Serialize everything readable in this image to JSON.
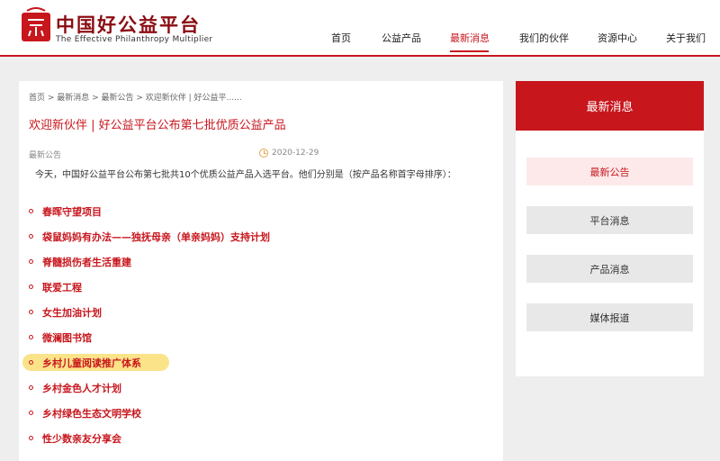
{
  "brand": {
    "name_cn": "中国好公益平台",
    "name_en": "The Effective Philanthropy Multiplier"
  },
  "nav": {
    "items": [
      {
        "label": "首页"
      },
      {
        "label": "公益产品"
      },
      {
        "label": "最新消息"
      },
      {
        "label": "我们的伙伴"
      },
      {
        "label": "资源中心"
      },
      {
        "label": "关于我们"
      }
    ],
    "active": "最新消息"
  },
  "breadcrumb": "首页 > 最新消息 > 最新公告 > 欢迎新伙伴 | 好公益平......",
  "article": {
    "title": "欢迎新伙伴 | 好公益平台公布第七批优质公益产品",
    "category": "最新公告",
    "date": "2020-12-29",
    "intro": "今天，中国好公益平台公布第七批共10个优质公益产品入选平台。他们分别是（按产品名称首字母排序）：",
    "items": [
      {
        "label": "春晖守望项目"
      },
      {
        "label": "袋鼠妈妈有办法——独抚母亲（单亲妈妈）支持计划"
      },
      {
        "label": "脊髓损伤者生活重建"
      },
      {
        "label": "联爱工程"
      },
      {
        "label": "女生加油计划"
      },
      {
        "label": "微澜图书馆"
      },
      {
        "label": "乡村儿童阅读推广体系"
      },
      {
        "label": "乡村金色人才计划"
      },
      {
        "label": "乡村绿色生态文明学校"
      },
      {
        "label": "性少数亲友分享会"
      }
    ],
    "highlighted_item": "乡村儿童阅读推广体系"
  },
  "sidebar": {
    "title": "最新消息",
    "items": [
      {
        "label": "最新公告"
      },
      {
        "label": "平台消息"
      },
      {
        "label": "产品消息"
      },
      {
        "label": "媒体报道"
      }
    ],
    "active": "最新公告"
  },
  "colors": {
    "accent": "#c8161d",
    "highlight": "#fbe38a",
    "page_bg": "#eeeeee"
  }
}
